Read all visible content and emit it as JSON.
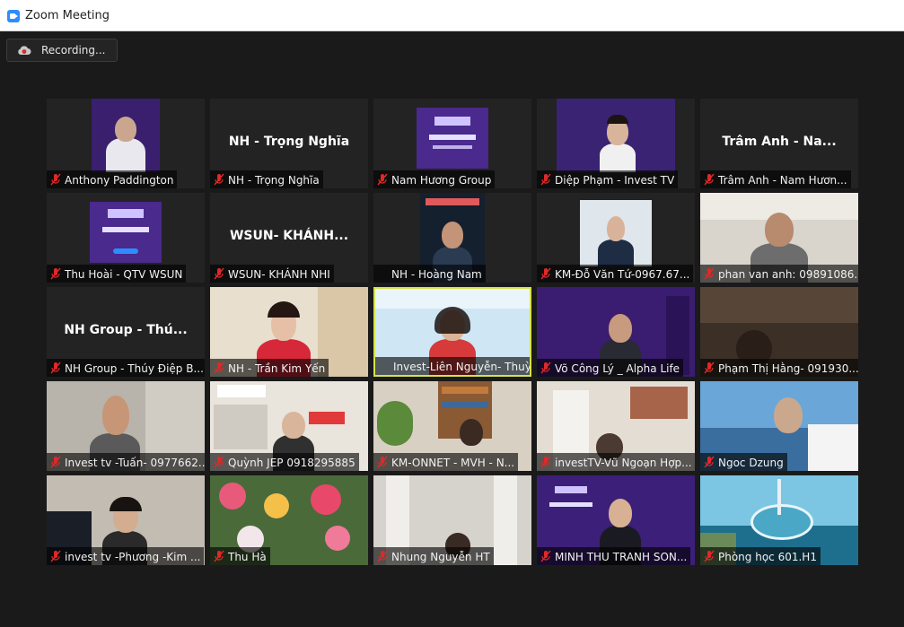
{
  "window": {
    "title": "Zoom Meeting"
  },
  "recording": {
    "label": "Recording..."
  },
  "colors": {
    "active_speaker_border": "#d7e24a",
    "mute_icon": "#e02828",
    "zoom_blue": "#2d8cff"
  },
  "participants": [
    {
      "label": "Anthony Paddington",
      "display_name": "",
      "muted": true
    },
    {
      "label": "NH - Trọng Nghĩa",
      "display_name": "NH - Trọng Nghĩa",
      "muted": true
    },
    {
      "label": "Nam Hương Group",
      "display_name": "",
      "muted": true
    },
    {
      "label": "Diệp Phạm - Invest TV",
      "display_name": "",
      "muted": true
    },
    {
      "label": "Trâm Anh -  Nam Hươn...",
      "display_name": "Trâm Anh -  Na...",
      "muted": true
    },
    {
      "label": "Thu Hoài - QTV WSUN",
      "display_name": "",
      "muted": true
    },
    {
      "label": "WSUN- KHÁNH NHI",
      "display_name": "WSUN-  KHÁNH...",
      "muted": true
    },
    {
      "label": "NH - Hoàng Nam",
      "display_name": "",
      "muted": false
    },
    {
      "label": "KM-Đỗ Văn Tứ-0967.67...",
      "display_name": "",
      "muted": true
    },
    {
      "label": "phan van anh: 09891086...",
      "display_name": "",
      "muted": true
    },
    {
      "label": "NH Group - Thúy Điệp B...",
      "display_name": "NH Group  - Thú...",
      "muted": true
    },
    {
      "label": "NH - Trần Kim Yến",
      "display_name": "",
      "muted": true
    },
    {
      "label": "Invest-Liên Nguyễn- Thuỳ Li...",
      "display_name": "",
      "muted": false
    },
    {
      "label": "Võ Công Lý _ Alpha Life",
      "display_name": "",
      "muted": true
    },
    {
      "label": "Phạm Thị Hằng- 091930...",
      "display_name": "",
      "muted": true
    },
    {
      "label": "Invest tv -Tuấn- 0977662...",
      "display_name": "",
      "muted": true
    },
    {
      "label": "Quỳnh JEP 0918295885",
      "display_name": "",
      "muted": true
    },
    {
      "label": "KM-ONNET - MVH - N...",
      "display_name": "",
      "muted": true
    },
    {
      "label": "investTV-Vũ Ngoạn Hợp...",
      "display_name": "",
      "muted": true
    },
    {
      "label": "Ngoc Dzung",
      "display_name": "",
      "muted": true
    },
    {
      "label": "invest tv -Phương -Kim ...",
      "display_name": "",
      "muted": true
    },
    {
      "label": "Thu Hà",
      "display_name": "",
      "muted": true
    },
    {
      "label": "Nhung Nguyễn HT",
      "display_name": "",
      "muted": true
    },
    {
      "label": "MINH THU TRANH SON...",
      "display_name": "",
      "muted": true
    },
    {
      "label": "Phòng học 601.H1",
      "display_name": "",
      "muted": true
    }
  ]
}
